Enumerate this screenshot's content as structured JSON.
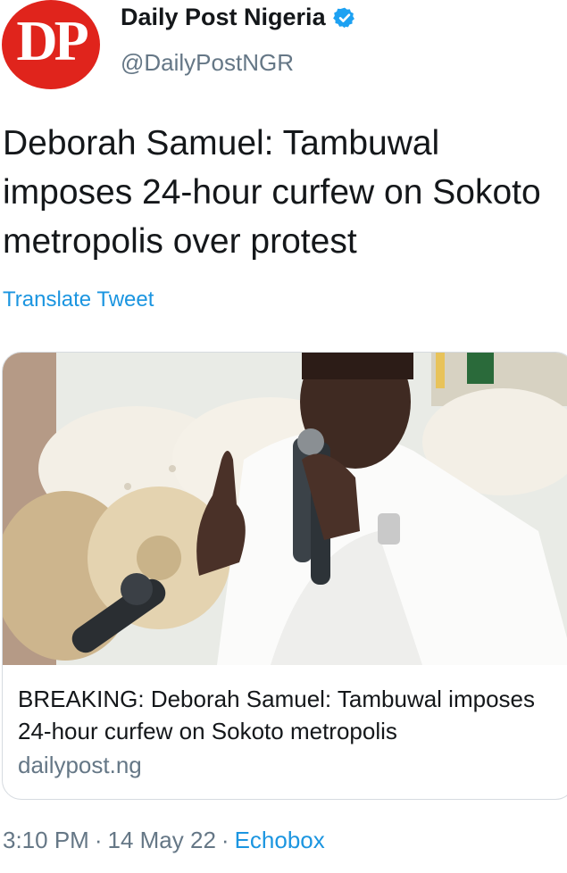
{
  "author": {
    "avatar_text": "DP",
    "display_name": "Daily Post Nigeria",
    "handle": "@DailyPostNGR"
  },
  "tweet": {
    "text": "Deborah Samuel: Tambuwal imposes 24-hour curfew on Sokoto metropolis over protest",
    "translate_label": "Translate Tweet"
  },
  "card": {
    "title": "BREAKING: Deborah Samuel: Tambuwal imposes 24-hour curfew on Sokoto metropolis",
    "domain": "dailypost.ng"
  },
  "meta": {
    "time": "3:10 PM",
    "date": "14 May 22",
    "source": "Echobox",
    "separator": "·"
  },
  "colors": {
    "brand_red": "#e0241c",
    "link_blue": "#1b95e0",
    "muted_gray": "#657786"
  }
}
